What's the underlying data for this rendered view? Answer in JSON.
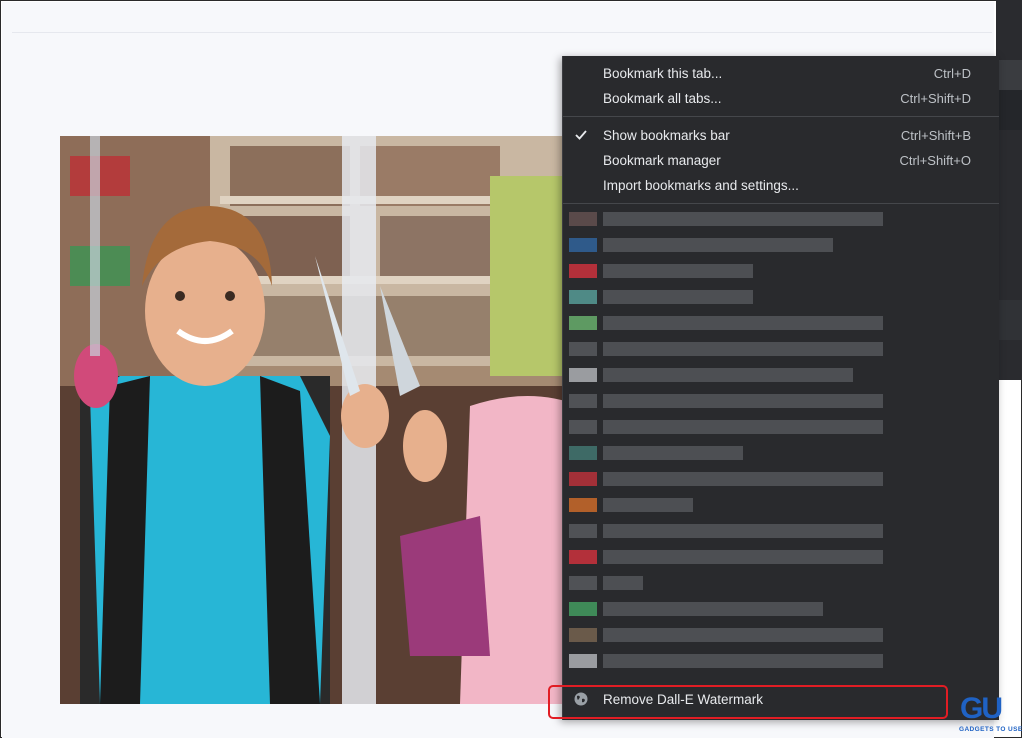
{
  "menu": {
    "items": [
      {
        "label": "Bookmark this tab...",
        "shortcut": "Ctrl+D"
      },
      {
        "label": "Bookmark all tabs...",
        "shortcut": "Ctrl+Shift+D"
      },
      {
        "label": "Show bookmarks bar",
        "shortcut": "Ctrl+Shift+B",
        "checked": true
      },
      {
        "label": "Bookmark manager",
        "shortcut": "Ctrl+Shift+O"
      },
      {
        "label": "Import bookmarks and settings...",
        "shortcut": ""
      }
    ],
    "remove_item": {
      "label": "Remove Dall-E Watermark",
      "icon": "globe-icon"
    }
  },
  "photo": {
    "flag_icon": "flag-icon"
  },
  "watermark": {
    "logo_text": "GU",
    "logo_sub": "GADGETS TO USE"
  },
  "colors": {
    "menu_bg": "#292a2d",
    "menu_text": "#e8eaed",
    "highlight_border": "#e11d24",
    "logo_blue": "#1f62c4"
  }
}
